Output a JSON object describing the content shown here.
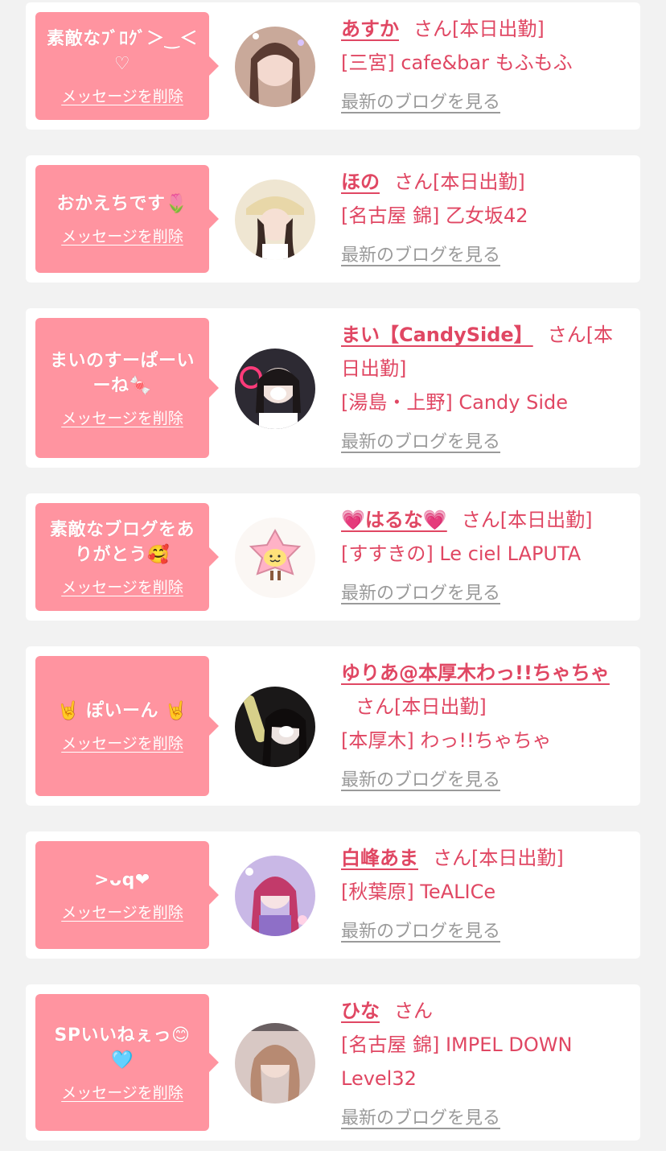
{
  "colors": {
    "bubble": "#ff94a0",
    "accent": "#e04763",
    "link_gray": "#9a9a9a",
    "background": "#f2f2f2"
  },
  "delete_label": "メッセージを削除",
  "san_label": "さん",
  "blog_label": "最新のブログを見る",
  "cards": [
    {
      "message": "素敵なﾌﾞﾛｸﾞ＞‿＜♡",
      "name": "あすか",
      "status": "[本日出勤]",
      "shop": "[三宮] cafe&bar もふもふ",
      "avatar_icon": "avatar-photo-icon"
    },
    {
      "message": "おかえちです🌷",
      "name": "ほの",
      "status": "[本日出勤]",
      "shop": "[名古屋 錦] 乙女坂42",
      "avatar_icon": "avatar-photo-icon"
    },
    {
      "message": "まいのすーぱーいーね🍬",
      "name": "まい【CandySide】",
      "status": "[本日出勤]",
      "shop": "[湯島・上野] Candy Side",
      "avatar_icon": "avatar-photo-icon"
    },
    {
      "message": "素敵なブログをありがとう🥰",
      "name": "💗はるな💗",
      "status": "[本日出勤]",
      "shop": "[すすきの] Le ciel LAPUTA",
      "avatar_icon": "sakura-mascot-icon"
    },
    {
      "message": "🤘 ぽいーん 🤘",
      "name": "ゆりあ@本厚木わっ!!ちゃちゃ",
      "status": "[本日出勤]",
      "shop": "[本厚木] わっ!!ちゃちゃ",
      "avatar_icon": "avatar-photo-icon"
    },
    {
      "message": ">ᴗq❤",
      "name": "白峰あま",
      "status": "[本日出勤]",
      "shop": "[秋葉原] TeALICe",
      "avatar_icon": "avatar-photo-icon"
    },
    {
      "message": "SPいいねぇっ😊🩵",
      "name": "ひな",
      "status": "",
      "shop": "[名古屋 錦] IMPEL DOWN Level32",
      "avatar_icon": "avatar-photo-icon"
    }
  ]
}
